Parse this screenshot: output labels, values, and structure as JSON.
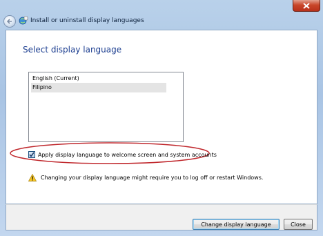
{
  "window": {
    "title": "Install or uninstall display languages",
    "back_icon": "back-arrow-icon",
    "app_icon": "globe-language-icon",
    "close_icon": "close-icon",
    "close_label": "x"
  },
  "main": {
    "heading": "Select display language",
    "languages": [
      {
        "label": "English (Current)",
        "selected": false
      },
      {
        "label": "Filipino",
        "selected": true
      }
    ],
    "checkbox": {
      "label": "Apply display language to welcome screen and system accounts",
      "checked": true,
      "highlight_color": "#c0282d"
    },
    "warning": {
      "icon": "warning-icon",
      "text": "Changing your display language might require you to log off or restart Windows."
    }
  },
  "footer": {
    "primary_button": "Change display language",
    "close_button": "Close"
  }
}
